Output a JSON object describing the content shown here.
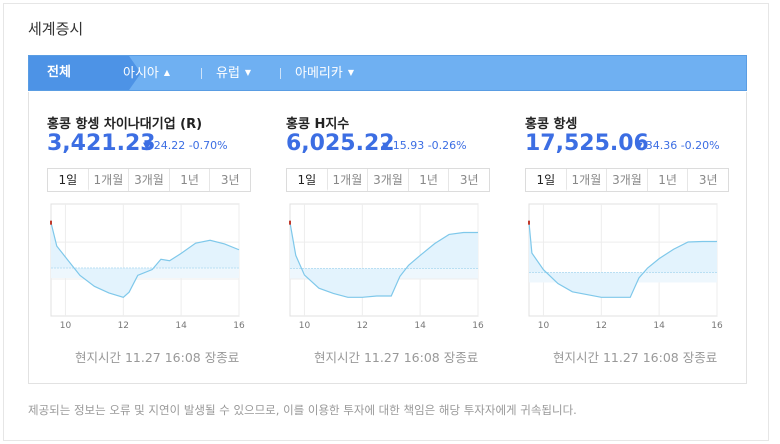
{
  "header": {
    "title": "세계증시"
  },
  "tabs": [
    {
      "label": "전체",
      "active": true
    },
    {
      "label": "아시아",
      "caret": "▲"
    },
    {
      "label": "유럽",
      "caret": "▼"
    },
    {
      "label": "아메리카",
      "caret": "▼"
    }
  ],
  "colors": {
    "accent": "#3c6ee3",
    "tabbar": "#6fb0f2",
    "tab_active": "#4d93e6",
    "chart_fill": "#e3f3fd",
    "chart_line": "#7fc8ea"
  },
  "period_tabs": [
    "1일",
    "1개월",
    "3개월",
    "1년",
    "3년"
  ],
  "cards": [
    {
      "name": "홍콩 항셍 차이나대기업 (R)",
      "price": "3,421.23",
      "change": "24.22 -0.70%",
      "status": "현지시간 11.27 16:08 장종료",
      "chart_data": {
        "type": "line",
        "x": [
          9.5,
          9.7,
          10,
          10.5,
          11,
          11.5,
          12,
          12.2,
          12.5,
          13,
          13.3,
          13.6,
          14,
          14.5,
          15,
          15.5,
          16
        ],
        "values": [
          0.62,
          0.3,
          0.15,
          -0.1,
          -0.25,
          -0.34,
          -0.4,
          -0.33,
          -0.1,
          -0.02,
          0.12,
          0.1,
          0.2,
          0.34,
          0.38,
          0.33,
          0.25
        ],
        "xticks": [
          "10",
          "12",
          "14",
          "16"
        ],
        "xlim": [
          9.5,
          16
        ]
      }
    },
    {
      "name": "홍콩 H지수",
      "price": "6,025.22",
      "change": "15.93 -0.26%",
      "status": "현지시간 11.27 16:08 장종료",
      "chart_data": {
        "type": "line",
        "x": [
          9.5,
          9.7,
          10,
          10.5,
          11,
          11.5,
          12,
          12.5,
          13,
          13.3,
          13.6,
          14,
          14.5,
          15,
          15.5,
          16
        ],
        "values": [
          0.7,
          0.2,
          -0.1,
          -0.3,
          -0.38,
          -0.44,
          -0.44,
          -0.42,
          -0.42,
          -0.12,
          0.05,
          0.2,
          0.38,
          0.52,
          0.55,
          0.55
        ],
        "xticks": [
          "10",
          "12",
          "14",
          "16"
        ],
        "xlim": [
          9.5,
          16
        ]
      }
    },
    {
      "name": "홍콩 항셍",
      "price": "17,525.06",
      "change": "34.36 -0.20%",
      "status": "현지시간 11.27 16:08 장종료",
      "chart_data": {
        "type": "line",
        "x": [
          9.5,
          9.6,
          10,
          10.5,
          11,
          11.5,
          12,
          12.5,
          13,
          13.3,
          13.6,
          14,
          14.5,
          15,
          15.5,
          16
        ],
        "values": [
          0.9,
          0.35,
          0.05,
          -0.2,
          -0.35,
          -0.4,
          -0.45,
          -0.45,
          -0.45,
          -0.1,
          0.08,
          0.25,
          0.42,
          0.55,
          0.56,
          0.56
        ],
        "xticks": [
          "10",
          "12",
          "14",
          "16"
        ],
        "xlim": [
          9.5,
          16
        ]
      }
    }
  ],
  "disclaimer": "제공되는 정보는 오류 및 지연이 발생될 수 있으므로, 이를 이용한 투자에 대한 책임은 해당 투자자에게 귀속됩니다."
}
